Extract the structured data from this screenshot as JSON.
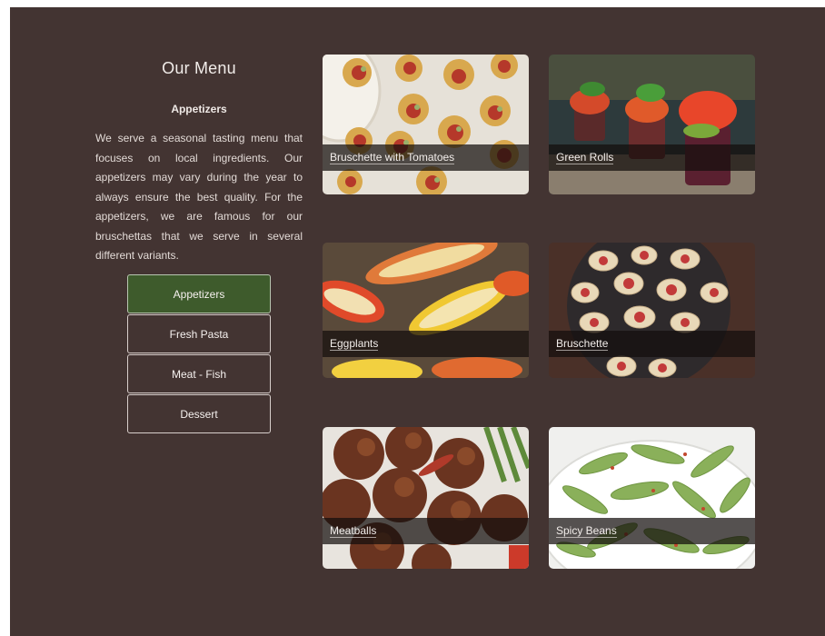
{
  "menu": {
    "title": "Our Menu",
    "section_title": "Appetizers",
    "description": "We serve a seasonal tasting menu that focuses on local ingredients. Our appetizers may vary during the year to always ensure the best quality. For the appetizers, we are famous for our bruschettas that we serve in several different variants."
  },
  "categories": [
    {
      "label": "Appetizers",
      "active": true
    },
    {
      "label": "Fresh Pasta",
      "active": false
    },
    {
      "label": "Meat - Fish",
      "active": false
    },
    {
      "label": "Dessert",
      "active": false
    }
  ],
  "dishes": [
    {
      "name": "Bruschette with Tomatoes",
      "icon": "bruschette-tomatoes-photo"
    },
    {
      "name": "Green Rolls",
      "icon": "green-rolls-photo"
    },
    {
      "name": "Eggplants",
      "icon": "eggplants-photo"
    },
    {
      "name": "Bruschette",
      "icon": "bruschette-photo"
    },
    {
      "name": "Meatballs",
      "icon": "meatballs-photo"
    },
    {
      "name": "Spicy Beans",
      "icon": "spicy-beans-photo"
    }
  ],
  "colors": {
    "background": "#433432",
    "active_button": "#3e5b2c",
    "text": "#f1ece9"
  }
}
